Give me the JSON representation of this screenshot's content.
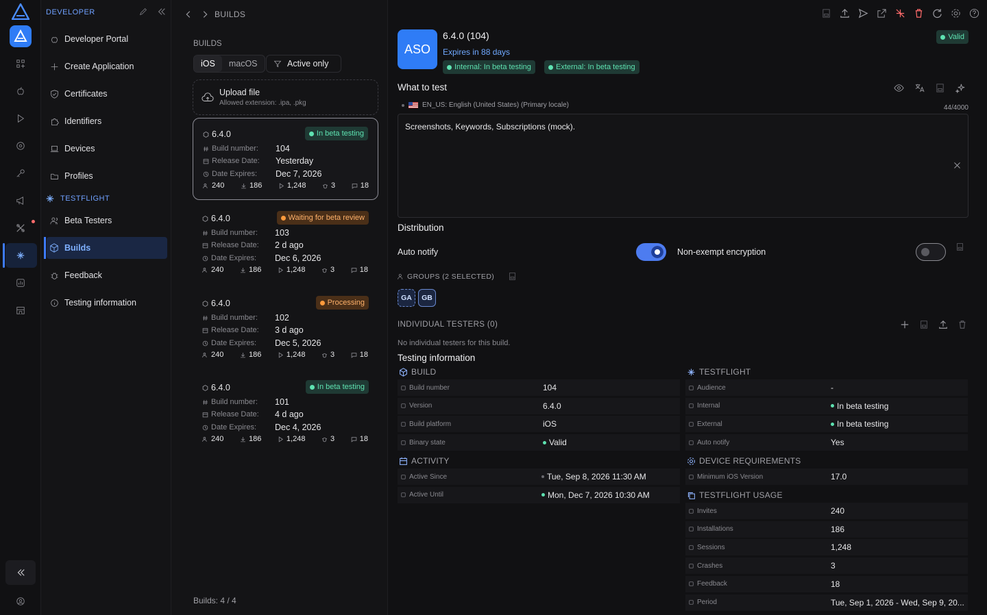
{
  "sidebar": {
    "header": "DEVELOPER",
    "items": [
      {
        "label": "Developer Portal",
        "icon": "portal-icon"
      },
      {
        "label": "Create Application",
        "icon": "plus-icon"
      },
      {
        "label": "Certificates",
        "icon": "shield-icon"
      },
      {
        "label": "Identifiers",
        "icon": "puzzle-icon"
      },
      {
        "label": "Devices",
        "icon": "laptop-icon"
      },
      {
        "label": "Profiles",
        "icon": "folder-icon"
      }
    ],
    "testflight_header": "TESTFLIGHT",
    "testflight_items": [
      {
        "label": "Beta Testers",
        "icon": "users-icon"
      },
      {
        "label": "Builds",
        "icon": "package-icon",
        "selected": true
      },
      {
        "label": "Feedback",
        "icon": "bug-icon"
      },
      {
        "label": "Testing information",
        "icon": "info-icon"
      }
    ]
  },
  "breadcrumb": "BUILDS",
  "builds_panel": {
    "title": "BUILDS",
    "platforms": [
      "iOS",
      "macOS"
    ],
    "filter_label": "Active only",
    "upload_title": "Upload file",
    "upload_hint": "Allowed extension: .ipa, .pkg",
    "labels": {
      "build_number": "Build number:",
      "release_date": "Release Date:",
      "date_expires": "Date Expires:"
    },
    "builds": [
      {
        "version": "6.4.0",
        "status": "In beta testing",
        "status_type": "green",
        "build_number": "104",
        "release_date": "Yesterday",
        "expires": "Dec 7, 2026",
        "testers": "240",
        "installs": "186",
        "sessions": "1,248",
        "crashes": "3",
        "feedback": "18",
        "selected": true
      },
      {
        "version": "6.4.0",
        "status": "Waiting for beta review",
        "status_type": "orange",
        "build_number": "103",
        "release_date": "2 d ago",
        "expires": "Dec 6, 2026",
        "testers": "240",
        "installs": "186",
        "sessions": "1,248",
        "crashes": "3",
        "feedback": "18"
      },
      {
        "version": "6.4.0",
        "status": "Processing",
        "status_type": "orange",
        "build_number": "102",
        "release_date": "3 d ago",
        "expires": "Dec 5, 2026",
        "testers": "240",
        "installs": "186",
        "sessions": "1,248",
        "crashes": "3",
        "feedback": "18"
      },
      {
        "version": "6.4.0",
        "status": "In beta testing",
        "status_type": "green",
        "build_number": "101",
        "release_date": "4 d ago",
        "expires": "Dec 4, 2026",
        "testers": "240",
        "installs": "186",
        "sessions": "1,248",
        "crashes": "3",
        "feedback": "18"
      }
    ],
    "count": "Builds: 4 / 4"
  },
  "detail": {
    "app_icon_text": "ASO",
    "title": "6.4.0 (104)",
    "expires": "Expires in 88 days",
    "internal_pill": "Internal: In beta testing",
    "external_pill": "External: In beta testing",
    "binary_badge": "Valid",
    "what_to_test": "What to test",
    "locale": "EN_US: English (United States) (Primary locale)",
    "char_count": "44/4000",
    "notes": "Screenshots, Keywords, Subscriptions (mock).",
    "distribution": "Distribution",
    "auto_notify": "Auto notify",
    "encryption": "Non-exempt encryption",
    "auto_notify_on": true,
    "encryption_on": false,
    "groups_header": "GROUPS (2 SELECTED)",
    "groups": [
      "GA",
      "GB"
    ],
    "individual_header": "INDIVIDUAL TESTERS (0)",
    "no_testers": "No individual testers for this build.",
    "testing_info": "Testing information",
    "build_section": {
      "title": "BUILD",
      "rows": [
        {
          "key": "Build number",
          "value": "104"
        },
        {
          "key": "Version",
          "value": "6.4.0"
        },
        {
          "key": "Build platform",
          "value": "iOS"
        },
        {
          "key": "Binary state",
          "value": "Valid"
        }
      ]
    },
    "activity_section": {
      "title": "ACTIVITY",
      "rows": [
        {
          "key": "Active Since",
          "value": "Tue, Sep 8, 2026 11:30 AM"
        },
        {
          "key": "Active Until",
          "value": "Mon, Dec 7, 2026 10:30 AM"
        }
      ]
    },
    "testflight_section": {
      "title": "TESTFLIGHT",
      "rows": [
        {
          "key": "Audience",
          "value": "-"
        },
        {
          "key": "Internal",
          "value": "In beta testing"
        },
        {
          "key": "External",
          "value": "In beta testing"
        },
        {
          "key": "Auto notify",
          "value": "Yes"
        }
      ]
    },
    "device_section": {
      "title": "DEVICE REQUIREMENTS",
      "rows": [
        {
          "key": "Minimum iOS Version",
          "value": "17.0"
        }
      ]
    },
    "usage_section": {
      "title": "TESTFLIGHT USAGE",
      "rows": [
        {
          "key": "Invites",
          "value": "240"
        },
        {
          "key": "Installations",
          "value": "186"
        },
        {
          "key": "Sessions",
          "value": "1,248"
        },
        {
          "key": "Crashes",
          "value": "3"
        },
        {
          "key": "Feedback",
          "value": "18"
        },
        {
          "key": "Period",
          "value": "Tue, Sep 1, 2026 - Wed, Sep 9, 20..."
        }
      ]
    }
  },
  "colors": {
    "accent": "#3d7bff",
    "success": "#5ee2b1",
    "warning": "#ff9a3c",
    "background": "#111113"
  }
}
